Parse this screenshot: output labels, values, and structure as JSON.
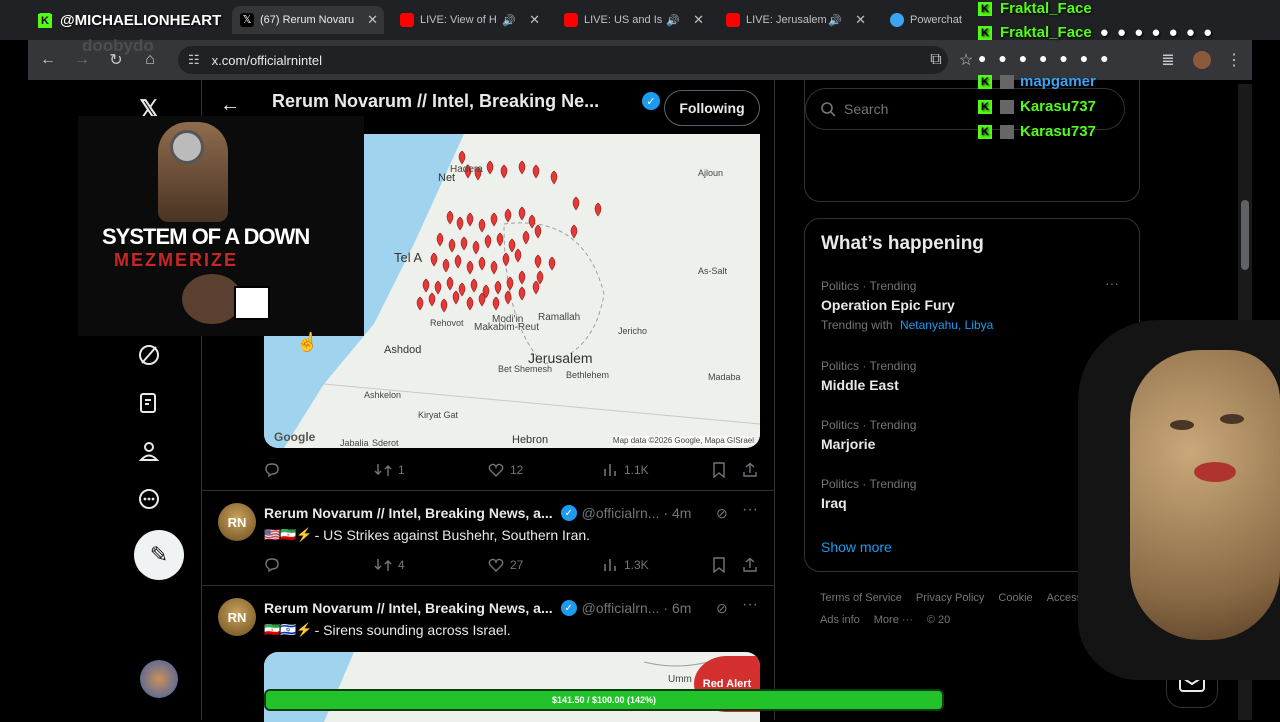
{
  "browser": {
    "tabs": [
      {
        "label": "(67) Rerum Novaru",
        "active": true
      },
      {
        "label": "LIVE: View of H"
      },
      {
        "label": "LIVE: US and Is"
      },
      {
        "label": "LIVE: Jerusalem"
      },
      {
        "label": "Powerchat"
      }
    ],
    "url": "x.com/officialrnintel"
  },
  "stream_overlay": {
    "streamer_handle": "@MICHAELIONHEART",
    "watermark": "doobydo",
    "album_title": "SYSTEM OF A DOWN",
    "album_subtitle": "MEZMERIZE",
    "chat": [
      {
        "user": "Fraktal_Face"
      },
      {
        "user": "Fraktal_Face"
      },
      {
        "user": "mapgamer"
      },
      {
        "user": "Karasu737"
      },
      {
        "user": "Karasu737"
      }
    ],
    "goal_bar": {
      "text": "$141.50 / $100.00 (142%)",
      "progress_pct": 100
    }
  },
  "profile_header": {
    "name": "Rerum Novarum // Intel, Breaking Ne...",
    "follow_label": "Following"
  },
  "map_post": {
    "map_labels": [
      "Hadera",
      "Net",
      "Tel A",
      "Ashdod",
      "Jerusalem",
      "Ramallah",
      "Modi'in",
      "Makabim-Reut",
      "Bet Shemesh",
      "Bethlehem",
      "Ashkelon",
      "Kiryat Gat",
      "Hebron",
      "Jericho",
      "As-Salt",
      "Ajloun",
      "Madaba",
      "Jabalia",
      "Sderot",
      "Rehovot"
    ],
    "map_attribution": "Map data ©2026 Google, Mapa GISrael",
    "google_logo": "Google",
    "actions": {
      "replies": "",
      "reposts": "1",
      "likes": "12",
      "views": "1.1K"
    }
  },
  "posts": [
    {
      "avatar": "RN",
      "name": "Rerum Novarum // Intel, Breaking News, a...",
      "handle": "@officialrn...",
      "time": "· 4m",
      "flags": "🇺🇸🇮🇷⚡",
      "text": "- US Strikes against Bushehr, Southern Iran.",
      "actions": {
        "replies": "",
        "reposts": "4",
        "likes": "27",
        "views": "1.3K"
      }
    },
    {
      "avatar": "RN",
      "name": "Rerum Novarum // Intel, Breaking News, a...",
      "handle": "@officialrn...",
      "time": "· 6m",
      "flags": "🇮🇷🇮🇱⚡",
      "text": "- Sirens sounding across Israel.",
      "badge": "Red Alert",
      "map_label": "Umm"
    }
  ],
  "search": {
    "placeholder": "Search"
  },
  "whats_happening": {
    "title": "What’s happening",
    "trends": [
      {
        "category": "Politics · Trending",
        "title": "Operation Epic Fury",
        "trending_with_label": "Trending with",
        "trending_with": "Netanyahu, Libya"
      },
      {
        "category": "Politics · Trending",
        "title": "Middle East"
      },
      {
        "category": "Politics · Trending",
        "title": "Marjorie"
      },
      {
        "category": "Politics · Trending",
        "title": "Iraq"
      }
    ],
    "show_more": "Show more"
  },
  "footer": {
    "links": [
      "Terms of Service",
      "Privacy Policy",
      "Cookie",
      "Accessibility",
      "Ads info",
      "More ···",
      "© 20"
    ]
  },
  "colors": {
    "accent": "#1d9bf0",
    "kick_green": "#53fc18",
    "pin_red": "#e53935"
  }
}
